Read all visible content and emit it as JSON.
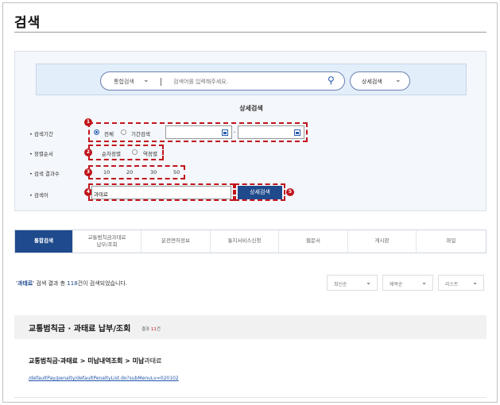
{
  "page": {
    "title": "검색"
  },
  "search": {
    "scope_label": "통합검색",
    "placeholder": "검색어를 입력해주세요.",
    "detail_toggle": "상세검색"
  },
  "detail": {
    "title": "상세검색",
    "period_label": "• 검색기간",
    "period_all": "전체",
    "period_range": "기간검색",
    "sort_label": "• 정렬순서",
    "sort_accuracy": "순차정렬",
    "sort_reverse": "역정렬",
    "count_label": "• 검색 결과수",
    "counts": [
      "10",
      "20",
      "30",
      "50"
    ],
    "keyword_label": "• 검색어",
    "keyword_value": "과태료",
    "search_button": "상세검색",
    "badges": [
      "1",
      "2",
      "3",
      "4",
      "5"
    ]
  },
  "tabs": [
    {
      "label": "통합검색",
      "active": true
    },
    {
      "label": "교통범칙금과태료\n납부/조회"
    },
    {
      "label": "운전면허정보"
    },
    {
      "label": "통지서비스신청"
    },
    {
      "label": "웹문서"
    },
    {
      "label": "게시판"
    },
    {
      "label": "파일"
    }
  ],
  "results": {
    "summary_prefix": "'",
    "keyword": "과태료",
    "summary_mid": "' 검색 결과 총 ",
    "total": "118",
    "summary_suffix": "건이 검색되었습니다.",
    "sort_options": [
      "최신순",
      "제목순",
      "리스트"
    ],
    "section_title": "교통범칙금 · 과태료 납부/조회",
    "section_count_prefix": "결과 ",
    "section_count": "11",
    "section_count_suffix": "건",
    "item_title": "교통범칙금·과태료 > 미납내역조회 > 미납",
    "item_title_tail": "과태료",
    "item_link": "/defaultPay/penalty/defaultPenaltyList.do?subMenuLv=020102"
  },
  "colors": {
    "accent": "#1f4a8c",
    "highlight": "#c0141b"
  }
}
